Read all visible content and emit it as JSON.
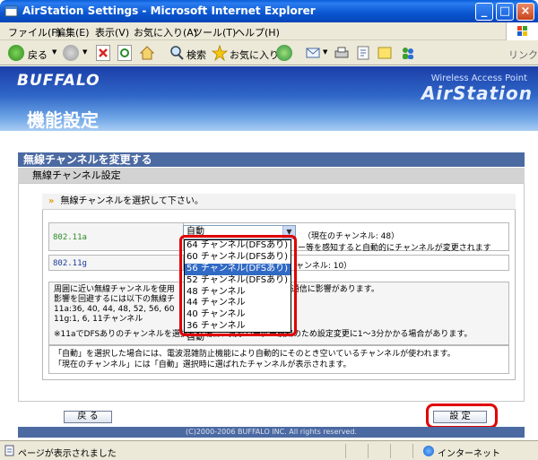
{
  "window": {
    "title": "AirStation Settings - Microsoft Internet Explorer"
  },
  "menu": [
    "ファイル(F)",
    "編集(E)",
    "表示(V)",
    "お気に入り(A)",
    "ツール(T)",
    "ヘルプ(H)"
  ],
  "toolbar": {
    "back": "戻る",
    "search": "検索",
    "favorites": "お気に入り",
    "links": "リンク"
  },
  "header": {
    "brand": "BUFFALO",
    "product_sub": "Wireless Access Point",
    "product": "AirStation",
    "page_title": "機能設定"
  },
  "section": {
    "title": "無線チャンネルを変更する",
    "subtitle": "無線チャンネル設定",
    "instruction": "無線チャンネルを選択して下さい。"
  },
  "rows": {
    "a_label": "802.11a",
    "a_selected": "自動",
    "a_current": "（現在のチャンネル: 48）",
    "a_note": "ー等を感知すると自動的にチャンネルが変更されます",
    "g_label": "802.11g",
    "g_current": "ャンネル: 10）"
  },
  "dropdown": {
    "options": [
      "64 チャンネル(DFSあり)",
      "60 チャンネル(DFSあり)",
      "56 チャンネル(DFSあり)",
      "52 チャンネル(DFSあり)",
      "48 チャンネル",
      "44 チャンネル",
      "40 チャンネル",
      "36 チャンネル",
      "自動"
    ],
    "highlighted_index": 2
  },
  "notes": {
    "line1": "周囲に近い無線チャンネルを使用",
    "line1b": "通信に影響があります。",
    "line2": "影響を回避するには以下の無線チ",
    "line3": "11a:36, 40, 44, 48, 52, 56, 60",
    "line4": "11g:1, 6, 11チャンネル",
    "line5": "※11aでDFSありのチャンネルを選択した場合、気象レーダー検知のため設定変更に1〜3分かかる場合があります。",
    "info1": "「自動」を選択した場合には、電波混雑防止機能により自動的にそのとき空いているチャンネルが使われます。",
    "info2": "「現在のチャンネル」には「自動」選択時に選ばれたチャンネルが表示されます。"
  },
  "buttons": {
    "back": "戻 る",
    "set": "設 定"
  },
  "footer": "(C)2000-2006 BUFFALO INC. All rights reserved.",
  "status": {
    "text": "ページが表示されました",
    "zone": "インターネット"
  },
  "colors": {
    "titlebar": "#0a55d0",
    "section_bar": "#4c6aa2",
    "highlight": "#316ac5",
    "annotation": "#e00000"
  }
}
